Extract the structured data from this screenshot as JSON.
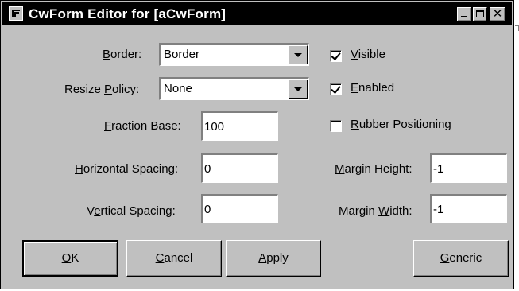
{
  "window": {
    "title": "CwForm Editor for [aCwForm]"
  },
  "labels": {
    "border_pre": "",
    "border_ul": "B",
    "border_post": "order:",
    "resize_pre": "Resize ",
    "resize_ul": "P",
    "resize_post": "olicy:",
    "fraction_pre": "",
    "fraction_ul": "F",
    "fraction_post": "raction Base:",
    "hspacing_pre": "",
    "hspacing_ul": "H",
    "hspacing_post": "orizontal Spacing:",
    "vspacing_pre": "V",
    "vspacing_ul": "e",
    "vspacing_post": "rtical Spacing:",
    "mheight_pre": "",
    "mheight_ul": "M",
    "mheight_post": "argin Height:",
    "mwidth_pre": "Margin ",
    "mwidth_ul": "W",
    "mwidth_post": "idth:"
  },
  "combos": {
    "border_value": "Border",
    "resize_value": "None"
  },
  "fields": {
    "fraction_base": "100",
    "horizontal_spacing": "0",
    "vertical_spacing": "0",
    "margin_height": "-1",
    "margin_width": "-1"
  },
  "checkboxes": {
    "visible": {
      "ul": "V",
      "rest": "isible",
      "checked": true
    },
    "enabled": {
      "ul": "E",
      "rest": "nabled",
      "checked": true
    },
    "rubber": {
      "ul": "R",
      "rest": "ubber Positioning",
      "checked": false
    }
  },
  "buttons": {
    "ok_ul": "O",
    "ok_rest": "K",
    "cancel_ul": "C",
    "cancel_rest": "ancel",
    "apply_ul": "A",
    "apply_rest": "pply",
    "generic_ul": "G",
    "generic_rest": "eneric"
  },
  "colors": {
    "face": "#c0c0c0",
    "titlebar": "#000000",
    "title_text": "#ffffff"
  },
  "icons": {
    "system_menu": "window-menu-icon",
    "minimize": "minimize-icon",
    "maximize": "maximize-icon",
    "close": "close-icon"
  }
}
